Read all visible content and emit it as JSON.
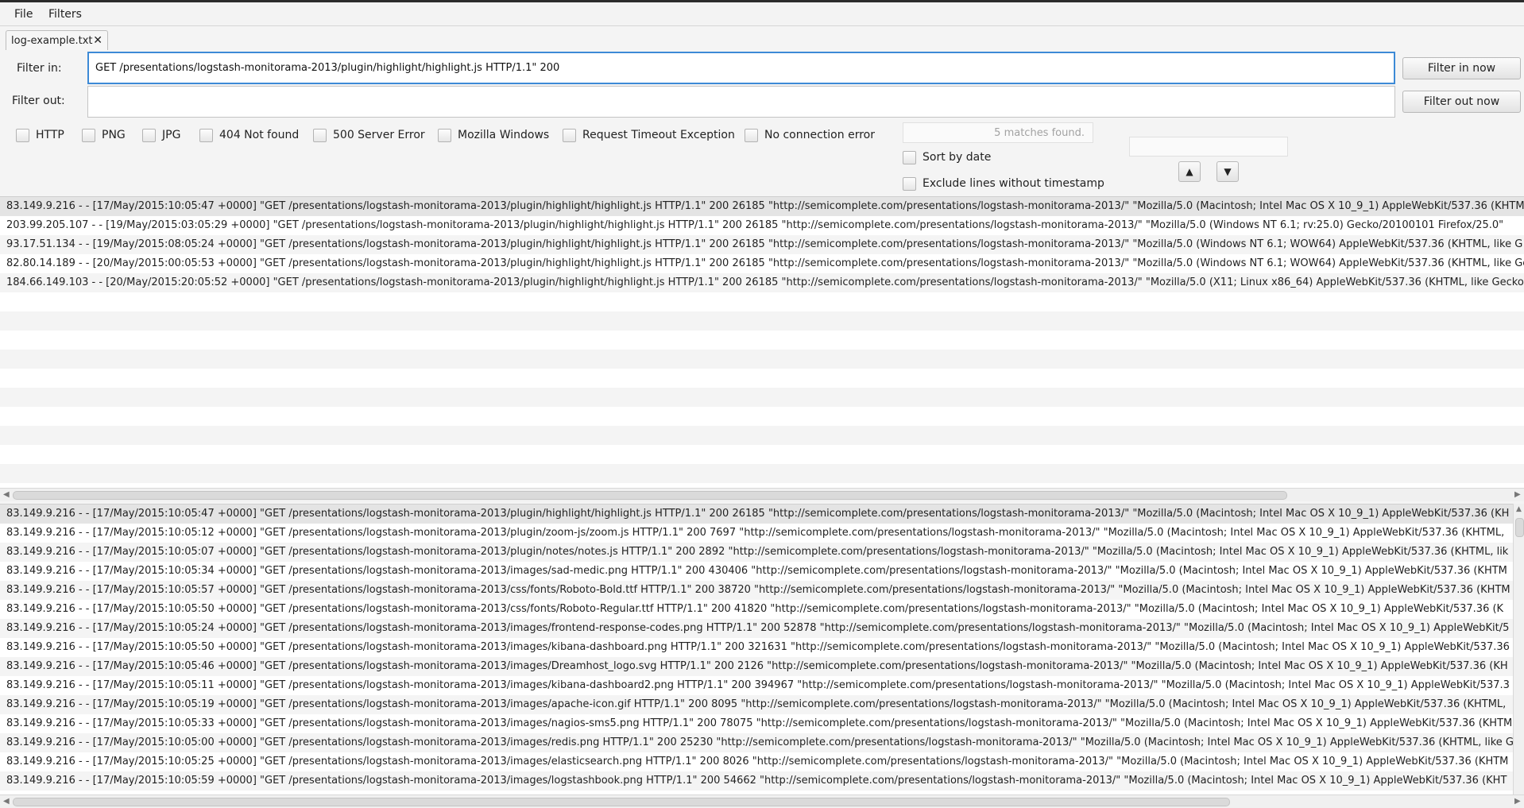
{
  "menu": {
    "file": "File",
    "filters": "Filters"
  },
  "tab": {
    "label": "log-example.txt",
    "close": "✕"
  },
  "filter_in": {
    "label": "Filter in:",
    "value": "GET /presentations/logstash-monitorama-2013/plugin/highlight/highlight.js HTTP/1.1\" 200",
    "button": "Filter in now"
  },
  "filter_out": {
    "label": "Filter out:",
    "value": "",
    "button": "Filter out now"
  },
  "quick_filters": [
    "HTTP",
    "PNG",
    "JPG",
    "404 Not found",
    "500 Server Error",
    "Mozilla Windows",
    "Request Timeout Exception",
    "No connection error"
  ],
  "matches_text": "5 matches found.",
  "sort_by_date": "Sort by date",
  "exclude_no_timestamp": "Exclude lines without timestamp",
  "search_value": "",
  "nav": {
    "up": "▲",
    "down": "▼"
  },
  "filtered_rows": [
    "83.149.9.216 - - [17/May/2015:10:05:47 +0000] \"GET /presentations/logstash-monitorama-2013/plugin/highlight/highlight.js HTTP/1.1\" 200 26185 \"http://semicomplete.com/presentations/logstash-monitorama-2013/\" \"Mozilla/5.0 (Macintosh; Intel Mac OS X 10_9_1) AppleWebKit/537.36 (KHTM",
    "203.99.205.107 - - [19/May/2015:03:05:29 +0000] \"GET /presentations/logstash-monitorama-2013/plugin/highlight/highlight.js HTTP/1.1\" 200 26185 \"http://semicomplete.com/presentations/logstash-monitorama-2013/\" \"Mozilla/5.0 (Windows NT 6.1; rv:25.0) Gecko/20100101 Firefox/25.0\"",
    "93.17.51.134 - - [19/May/2015:08:05:24 +0000] \"GET /presentations/logstash-monitorama-2013/plugin/highlight/highlight.js HTTP/1.1\" 200 26185 \"http://semicomplete.com/presentations/logstash-monitorama-2013/\" \"Mozilla/5.0 (Windows NT 6.1; WOW64) AppleWebKit/537.36 (KHTML, like G",
    "82.80.14.189 - - [20/May/2015:00:05:53 +0000] \"GET /presentations/logstash-monitorama-2013/plugin/highlight/highlight.js HTTP/1.1\" 200 26185 \"http://semicomplete.com/presentations/logstash-monitorama-2013/\" \"Mozilla/5.0 (Windows NT 6.1; WOW64) AppleWebKit/537.36 (KHTML, like Ge",
    "184.66.149.103 - - [20/May/2015:20:05:52 +0000] \"GET /presentations/logstash-monitorama-2013/plugin/highlight/highlight.js HTTP/1.1\" 200 26185 \"http://semicomplete.com/presentations/logstash-monitorama-2013/\" \"Mozilla/5.0 (X11; Linux x86_64) AppleWebKit/537.36 (KHTML, like Gecko"
  ],
  "all_rows": [
    "83.149.9.216 - - [17/May/2015:10:05:47 +0000] \"GET /presentations/logstash-monitorama-2013/plugin/highlight/highlight.js HTTP/1.1\" 200 26185 \"http://semicomplete.com/presentations/logstash-monitorama-2013/\" \"Mozilla/5.0 (Macintosh; Intel Mac OS X 10_9_1) AppleWebKit/537.36 (KH",
    "83.149.9.216 - - [17/May/2015:10:05:12 +0000] \"GET /presentations/logstash-monitorama-2013/plugin/zoom-js/zoom.js HTTP/1.1\" 200 7697 \"http://semicomplete.com/presentations/logstash-monitorama-2013/\" \"Mozilla/5.0 (Macintosh; Intel Mac OS X 10_9_1) AppleWebKit/537.36 (KHTML,",
    "83.149.9.216 - - [17/May/2015:10:05:07 +0000] \"GET /presentations/logstash-monitorama-2013/plugin/notes/notes.js HTTP/1.1\" 200 2892 \"http://semicomplete.com/presentations/logstash-monitorama-2013/\" \"Mozilla/5.0 (Macintosh; Intel Mac OS X 10_9_1) AppleWebKit/537.36 (KHTML, lik",
    "83.149.9.216 - - [17/May/2015:10:05:34 +0000] \"GET /presentations/logstash-monitorama-2013/images/sad-medic.png HTTP/1.1\" 200 430406 \"http://semicomplete.com/presentations/logstash-monitorama-2013/\" \"Mozilla/5.0 (Macintosh; Intel Mac OS X 10_9_1) AppleWebKit/537.36 (KHTM",
    "83.149.9.216 - - [17/May/2015:10:05:57 +0000] \"GET /presentations/logstash-monitorama-2013/css/fonts/Roboto-Bold.ttf HTTP/1.1\" 200 38720 \"http://semicomplete.com/presentations/logstash-monitorama-2013/\" \"Mozilla/5.0 (Macintosh; Intel Mac OS X 10_9_1) AppleWebKit/537.36 (KHTM",
    "83.149.9.216 - - [17/May/2015:10:05:50 +0000] \"GET /presentations/logstash-monitorama-2013/css/fonts/Roboto-Regular.ttf HTTP/1.1\" 200 41820 \"http://semicomplete.com/presentations/logstash-monitorama-2013/\" \"Mozilla/5.0 (Macintosh; Intel Mac OS X 10_9_1) AppleWebKit/537.36 (K",
    "83.149.9.216 - - [17/May/2015:10:05:24 +0000] \"GET /presentations/logstash-monitorama-2013/images/frontend-response-codes.png HTTP/1.1\" 200 52878 \"http://semicomplete.com/presentations/logstash-monitorama-2013/\" \"Mozilla/5.0 (Macintosh; Intel Mac OS X 10_9_1) AppleWebKit/5",
    "83.149.9.216 - - [17/May/2015:10:05:50 +0000] \"GET /presentations/logstash-monitorama-2013/images/kibana-dashboard.png HTTP/1.1\" 200 321631 \"http://semicomplete.com/presentations/logstash-monitorama-2013/\" \"Mozilla/5.0 (Macintosh; Intel Mac OS X 10_9_1) AppleWebKit/537.36",
    "83.149.9.216 - - [17/May/2015:10:05:46 +0000] \"GET /presentations/logstash-monitorama-2013/images/Dreamhost_logo.svg HTTP/1.1\" 200 2126 \"http://semicomplete.com/presentations/logstash-monitorama-2013/\" \"Mozilla/5.0 (Macintosh; Intel Mac OS X 10_9_1) AppleWebKit/537.36 (KH",
    "83.149.9.216 - - [17/May/2015:10:05:11 +0000] \"GET /presentations/logstash-monitorama-2013/images/kibana-dashboard2.png HTTP/1.1\" 200 394967 \"http://semicomplete.com/presentations/logstash-monitorama-2013/\" \"Mozilla/5.0 (Macintosh; Intel Mac OS X 10_9_1) AppleWebKit/537.3",
    "83.149.9.216 - - [17/May/2015:10:05:19 +0000] \"GET /presentations/logstash-monitorama-2013/images/apache-icon.gif HTTP/1.1\" 200 8095 \"http://semicomplete.com/presentations/logstash-monitorama-2013/\" \"Mozilla/5.0 (Macintosh; Intel Mac OS X 10_9_1) AppleWebKit/537.36 (KHTML,",
    "83.149.9.216 - - [17/May/2015:10:05:33 +0000] \"GET /presentations/logstash-monitorama-2013/images/nagios-sms5.png HTTP/1.1\" 200 78075 \"http://semicomplete.com/presentations/logstash-monitorama-2013/\" \"Mozilla/5.0 (Macintosh; Intel Mac OS X 10_9_1) AppleWebKit/537.36 (KHTM",
    "83.149.9.216 - - [17/May/2015:10:05:00 +0000] \"GET /presentations/logstash-monitorama-2013/images/redis.png HTTP/1.1\" 200 25230 \"http://semicomplete.com/presentations/logstash-monitorama-2013/\" \"Mozilla/5.0 (Macintosh; Intel Mac OS X 10_9_1) AppleWebKit/537.36 (KHTML, like G",
    "83.149.9.216 - - [17/May/2015:10:05:25 +0000] \"GET /presentations/logstash-monitorama-2013/images/elasticsearch.png HTTP/1.1\" 200 8026 \"http://semicomplete.com/presentations/logstash-monitorama-2013/\" \"Mozilla/5.0 (Macintosh; Intel Mac OS X 10_9_1) AppleWebKit/537.36 (KHTM",
    "83.149.9.216 - - [17/May/2015:10:05:59 +0000] \"GET /presentations/logstash-monitorama-2013/images/logstashbook.png HTTP/1.1\" 200 54662 \"http://semicomplete.com/presentations/logstash-monitorama-2013/\" \"Mozilla/5.0 (Macintosh; Intel Mac OS X 10_9_1) AppleWebKit/537.36 (KHT"
  ]
}
